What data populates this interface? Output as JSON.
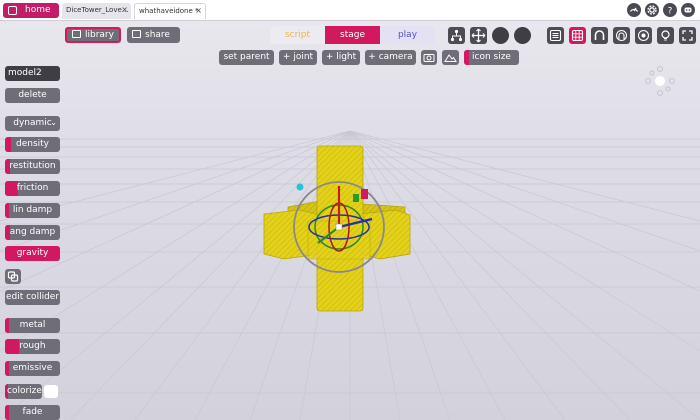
{
  "tabbar": {
    "home_label": "home",
    "tabs": [
      {
        "label": "DiceTower_Love...",
        "close": "×"
      },
      {
        "label": "whathaveidone *",
        "close": "×"
      }
    ],
    "right_icons": [
      "speed-icon",
      "settings-icon",
      "help-icon",
      "discord-icon",
      "fullscreen-icon"
    ]
  },
  "toolbar": {
    "library_label": "library",
    "share_label": "share",
    "modes": {
      "script": "script",
      "stage": "stage",
      "play": "play"
    },
    "set_parent_label": "set parent",
    "joint_label": "joint",
    "light_label": "light",
    "camera_label": "camera",
    "icon_size_label": "icon size",
    "colors": {
      "accent": "#d2195f",
      "script": "#e9b84f",
      "play": "#5a51c7",
      "button": "#6f6e78"
    }
  },
  "left_panel": {
    "object_name": "model2",
    "delete_label": "delete",
    "body_type": "dynamic",
    "properties": [
      {
        "label": "density",
        "level": 0.12
      },
      {
        "label": "restitution",
        "level": 0.1
      },
      {
        "label": "friction",
        "level": 0.23
      },
      {
        "label": "lin damp",
        "level": 0.08
      },
      {
        "label": "ang damp",
        "level": 0.1
      },
      {
        "label": "gravity",
        "level": 1.0
      }
    ],
    "edit_collider_label": "edit collider",
    "materials": [
      {
        "label": "metal",
        "level": 0.08
      },
      {
        "label": "rough",
        "level": 0.25
      },
      {
        "label": "emissive",
        "level": 0.08
      },
      {
        "label": "colorize",
        "level": 0.08
      },
      {
        "label": "fade",
        "level": 0.08
      }
    ],
    "colorize_value": "#ffffff"
  },
  "scene": {
    "model_color": "#e4d21a",
    "selected_object": "model2"
  }
}
